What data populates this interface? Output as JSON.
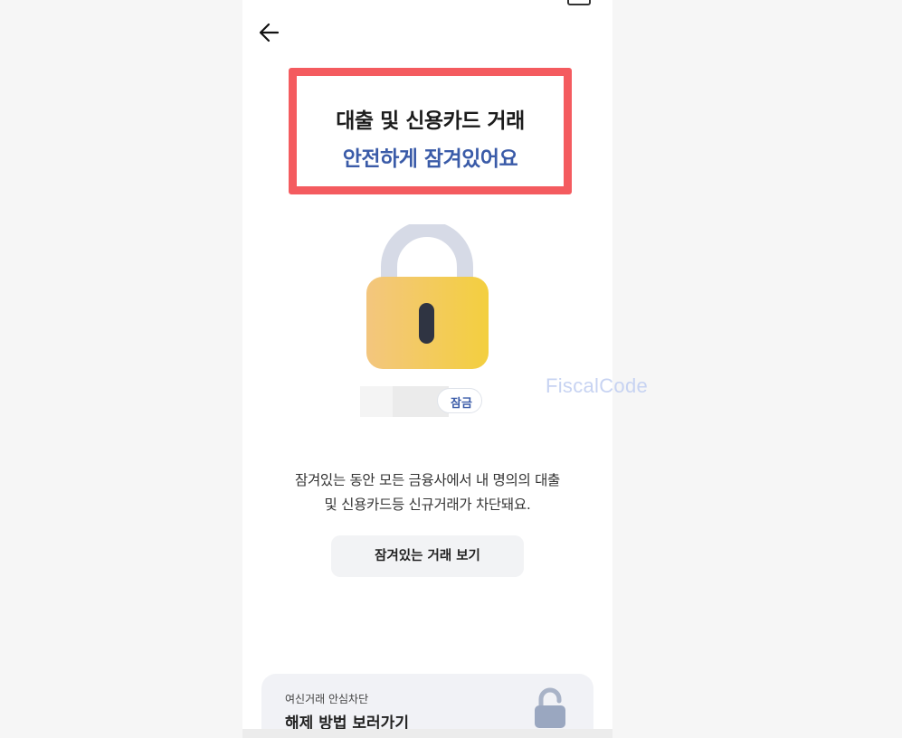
{
  "header": {
    "back_icon": "arrow-left-icon"
  },
  "highlight": {
    "line1": "대출 및 신용카드 거래",
    "line2": "안전하게 잠겨있어요",
    "border_color": "#f45b5f",
    "accent_color": "#3a5ba8"
  },
  "lock": {
    "icon": "padlock-locked-icon",
    "status_label": "잠금"
  },
  "description": {
    "line1": "잠겨있는 동안 모든 금융사에서 내 명의의 대출",
    "line2": "및 신용카드등 신규거래가 차단돼요."
  },
  "actions": {
    "view_label": "잠겨있는 거래 보기"
  },
  "guide_card": {
    "subtitle": "여신거래 안심차단",
    "title": "해제 방법 보러가기",
    "icon": "padlock-unlocked-icon"
  },
  "watermark": {
    "text": "FiscalCode"
  }
}
